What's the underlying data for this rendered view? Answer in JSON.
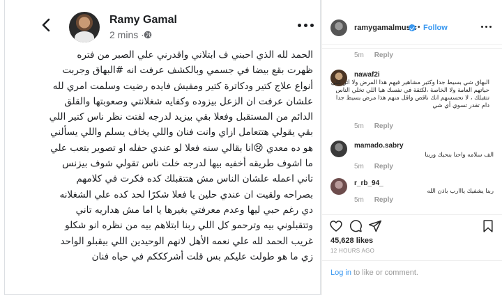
{
  "post": {
    "author": "Ramy Gamal",
    "time": "2 mins ·",
    "icons": {
      "back": "back-arrow-icon",
      "globe": "globe-icon",
      "more": "more-horizontal-icon"
    },
    "body": "الحمد لله الذي احبني ف ابتلاني واقدرني علي الصبر من فتره ظهرت بقع بيضا في جسمي وبالكشف عرفت انه #البهاق وجربت أنواع علاج كتير ودكاترة كتير ومفيش فايده رضيت وسلمت امري لله علشان عرفت ان الزعل بيزوده وكفايه شغلانتي وصعوبتها والقلق الدائم من المستقبل وفعلا بقي بيزيد لدرجه لفتت نظر ناس كتير اللي بقي يقولي هتتعامل ازاي وانت فنان واللي يخاف يسلم واللي يسألني هو ده معدي 😢انا بقالي سنه فعلا لو عندي حفله او تصوير بتعب علي ما اشوف طريقه أخفيه بيها لدرجه خلت ناس تقولي شوف بيزنس تاني اعمله علشان الناس مش هتتقبلك كده فكرت في كلامهم بصراحه ولقيت ان عندي حلين يا فعلا شكرًا لحد كده علي الشغلانه دي رغم حبي ليها وعدم معرفتي بغيرها يا اما مش هداريه تاني وتتقبلوني بيه وترحمو كل اللي ربنا ابتلاهم بيه من نظره انو شكلو غريب الحمد لله علي نعمه الأهل لانهم الوحيدين اللي بيقبلو الواحد زي ما هو طولت عليكم بس قلت أشركككم في حياه فنان"
  },
  "instagram": {
    "username": "ramygamalmusic",
    "follow_sep": "•",
    "follow_label": "Follow",
    "comments": [
      {
        "time": "5m",
        "reply": "Reply"
      },
      {
        "user": "nawaf2i",
        "text": "البهاق شي بسيط جدا وكثير مشاهير فيهم هذا المرض ولا أثر على حياتهم العامة ولا الخاصة ،لكثقة في نفسك هيا اللي تخلي الناس تتقبلك ، لا تحسسهم انك ناقص واقل منهم هذا مرض بسيط جدا دام تقدر تسوي أي شي",
        "time": "5m",
        "reply": "Reply"
      },
      {
        "user": "mamado.sabry",
        "text": "الف سلامه واحنا بنحبك وربنا",
        "time": "5m",
        "reply": "Reply"
      },
      {
        "user": "r_rb_94_",
        "text": "ربنا يشفيك يااارب باذن الله",
        "time": "5m",
        "reply": "Reply"
      }
    ],
    "likes": "45,628 likes",
    "time_ago": "12 HOURS AGO",
    "login_link": "Log in",
    "login_rest": " to like or comment."
  }
}
